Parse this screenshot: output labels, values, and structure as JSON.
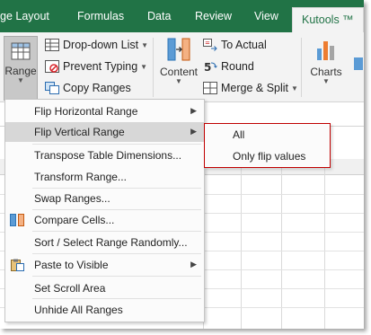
{
  "ribbon_tabs": [
    {
      "label": "ge Layout"
    },
    {
      "label": "Formulas"
    },
    {
      "label": "Data"
    },
    {
      "label": "Review"
    },
    {
      "label": "View"
    },
    {
      "label": "Kutools ™"
    }
  ],
  "ribbon": {
    "range_label": "Range",
    "dropdown_list_label": "Drop-down List",
    "prevent_typing_label": "Prevent Typing",
    "copy_ranges_label": "Copy Ranges",
    "content_label": "Content",
    "to_actual_label": "To Actual",
    "round_label": "Round",
    "merge_split_label": "Merge & Split",
    "charts_label": "Charts"
  },
  "range_menu": {
    "items": [
      {
        "label": "Flip Horizontal Range",
        "has_submenu": true
      },
      {
        "label": "Flip Vertical Range",
        "has_submenu": true,
        "highlighted": true
      },
      {
        "label": "Transpose Table Dimensions..."
      },
      {
        "label": "Transform Range..."
      },
      {
        "label": "Swap Ranges..."
      },
      {
        "label": "Compare Cells..."
      },
      {
        "label": "Sort / Select Range Randomly..."
      },
      {
        "label": "Paste to Visible",
        "has_submenu": true
      },
      {
        "label": "Set Scroll Area"
      },
      {
        "label": "Unhide All Ranges"
      }
    ]
  },
  "flip_vertical_submenu": {
    "items": [
      {
        "label": "All"
      },
      {
        "label": "Only flip values"
      }
    ]
  },
  "colors": {
    "tab_bar_green": "#217346",
    "submenu_border": "#c00000",
    "highlight": "#d7d7d7"
  }
}
